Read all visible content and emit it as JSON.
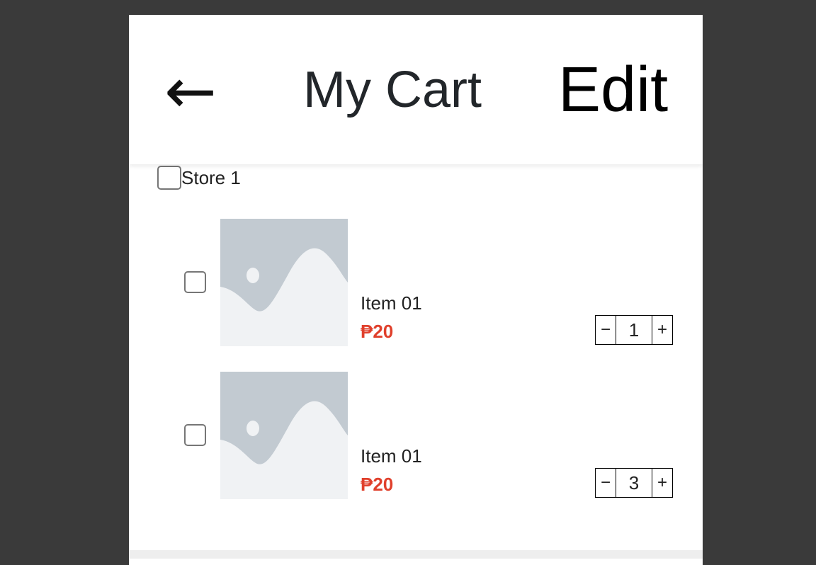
{
  "header": {
    "back_glyph": "←",
    "title": "My Cart",
    "edit_label": "Edit"
  },
  "store": {
    "name": "Store 1"
  },
  "items": [
    {
      "name": "Item 01",
      "price": "₱20",
      "quantity": "1",
      "decrement": "−",
      "increment": "+"
    },
    {
      "name": "Item 01",
      "price": "₱20",
      "quantity": "3",
      "decrement": "−",
      "increment": "+"
    }
  ],
  "icons": {
    "back": "back-arrow-icon",
    "thumbnail": "image-placeholder-icon"
  },
  "colors": {
    "background": "#3a3a3a",
    "panel": "#ffffff",
    "price": "#e0402c",
    "placeholder_sky": "#c2cad1",
    "placeholder_land": "#f0f2f4"
  }
}
